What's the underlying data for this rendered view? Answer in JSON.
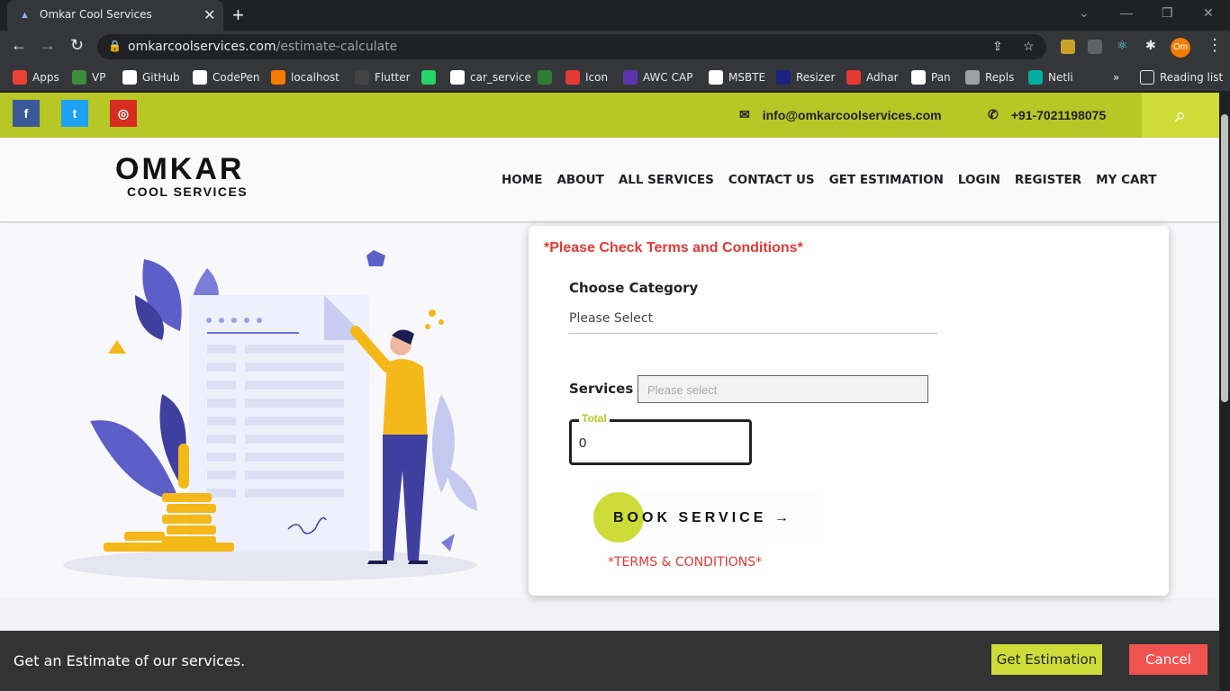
{
  "browser": {
    "tab_title": "Omkar Cool Services",
    "url_host": "omkarcoolservices.com",
    "url_path": "/estimate-calculate",
    "profile_initials": "Om",
    "bookmarks": [
      {
        "label": "Apps",
        "color": "#e94235"
      },
      {
        "label": "VP",
        "color": "#3c8d3c"
      },
      {
        "label": "GitHub",
        "color": "#ffffff"
      },
      {
        "label": "CodePen",
        "color": "#ffffff"
      },
      {
        "label": "localhost",
        "color": "#f57c00"
      },
      {
        "label": "Flutter",
        "color": "#444444"
      },
      {
        "label": "",
        "color": "#25d366"
      },
      {
        "label": "car_service",
        "color": "#ffffff"
      },
      {
        "label": "",
        "color": "#2e7d32"
      },
      {
        "label": "Icon",
        "color": "#e53935"
      },
      {
        "label": "AWC CAP",
        "color": "#5e35b1"
      },
      {
        "label": "MSBTE",
        "color": "#ffffff"
      },
      {
        "label": "Resizer",
        "color": "#1a237e"
      },
      {
        "label": "Adhar",
        "color": "#e53935"
      },
      {
        "label": "Pan",
        "color": "#ffffff"
      },
      {
        "label": "Repls",
        "color": "#9aa0a6"
      },
      {
        "label": "Netli",
        "color": "#00ad9f"
      }
    ],
    "more_bookmarks": "»",
    "reading_list": "Reading list"
  },
  "topbar": {
    "email": "info@omkarcoolservices.com",
    "phone": "+91-7021198075",
    "accent": "#b7c725"
  },
  "logo": {
    "main": "OMKAR",
    "sub": "COOL SERVICES"
  },
  "nav": [
    "HOME",
    "ABOUT",
    "ALL SERVICES",
    "CONTACT US",
    "GET ESTIMATION",
    "LOGIN",
    "REGISTER",
    "MY CART"
  ],
  "form": {
    "warning": "*Please Check Terms and Conditions*",
    "category_label": "Choose Category",
    "category_value": "Please Select",
    "services_label": "Services",
    "services_placeholder": "Please select",
    "total_label": "Total",
    "total_value": "0",
    "book_label": "BOOK SERVICE",
    "book_arrow": "→",
    "terms": "*TERMS & CONDITIONS*"
  },
  "banner": {
    "text": "Get an Estimate of our services.",
    "estimation_button": "Get Estimation",
    "cancel_button": "Cancel"
  }
}
